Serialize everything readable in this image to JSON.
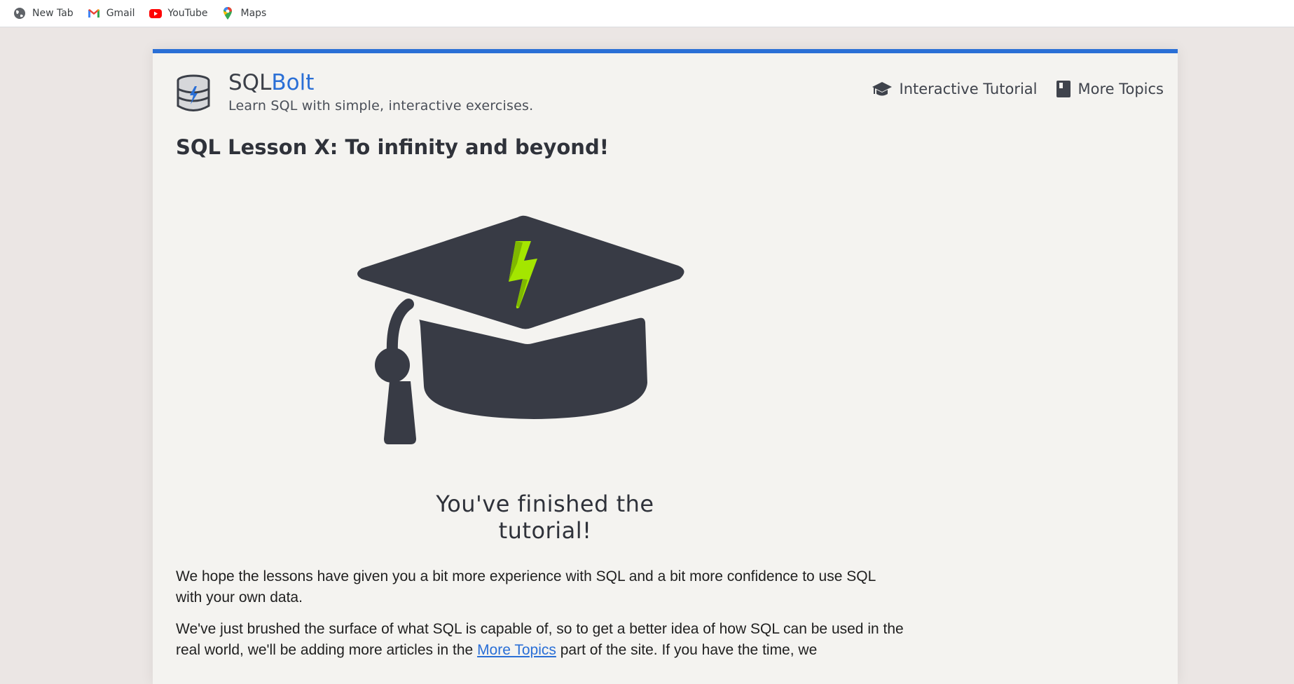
{
  "bookmarks": [
    {
      "label": "New Tab",
      "icon": "globe-icon"
    },
    {
      "label": "Gmail",
      "icon": "gmail-icon"
    },
    {
      "label": "YouTube",
      "icon": "youtube-icon"
    },
    {
      "label": "Maps",
      "icon": "maps-icon"
    }
  ],
  "header": {
    "brand_sql": "SQL",
    "brand_bolt": "Bolt",
    "tagline": "Learn SQL with simple, interactive exercises.",
    "nav": [
      {
        "label": "Interactive Tutorial",
        "icon": "graduation-cap-icon"
      },
      {
        "label": "More Topics",
        "icon": "book-icon"
      }
    ]
  },
  "lesson": {
    "title": "SQL Lesson X: To infinity and beyond!",
    "finished_text": "You've finished the tutorial!",
    "para1": "We hope the lessons have given you a bit more experience with SQL and a bit more confidence to use SQL with your own data.",
    "para2_before": "We've just brushed the surface of what SQL is capable of, so to get a better idea of how SQL can be used in the real world, we'll be adding more articles in the ",
    "para2_link": "More Topics",
    "para2_after": " part of the site. If you have the time, we"
  },
  "colors": {
    "accent": "#2a6fd6",
    "cap_dark": "#383b45",
    "bolt_green": "#a4e600"
  }
}
